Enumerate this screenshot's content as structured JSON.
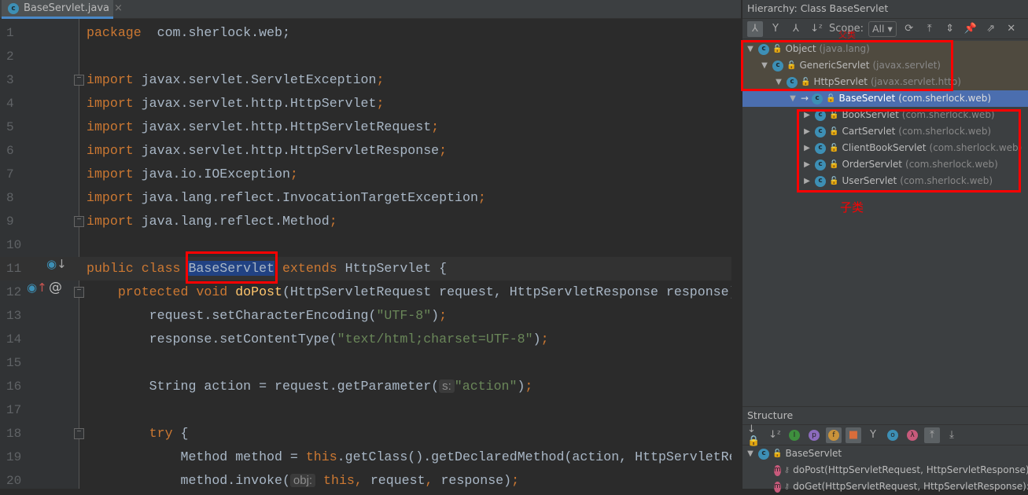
{
  "editor": {
    "tab": {
      "filename": "BaseServlet.java",
      "icon": "class-icon",
      "close": "×"
    },
    "lines": [
      {
        "n": "1",
        "tokens": [
          [
            "kw",
            "package"
          ],
          [
            "",
            "  com.sherlock.web;"
          ]
        ]
      },
      {
        "n": "2",
        "tokens": []
      },
      {
        "n": "3",
        "fold": true,
        "tokens": [
          [
            "kw",
            "import"
          ],
          [
            "",
            " javax.servlet.ServletException"
          ],
          [
            "kw",
            ";"
          ]
        ]
      },
      {
        "n": "4",
        "tokens": [
          [
            "kw",
            "import"
          ],
          [
            "",
            " javax.servlet.http.HttpServlet"
          ],
          [
            "kw",
            ";"
          ]
        ]
      },
      {
        "n": "5",
        "tokens": [
          [
            "kw",
            "import"
          ],
          [
            "",
            " javax.servlet.http.HttpServletRequest"
          ],
          [
            "kw",
            ";"
          ]
        ]
      },
      {
        "n": "6",
        "tokens": [
          [
            "kw",
            "import"
          ],
          [
            "",
            " javax.servlet.http.HttpServletResponse"
          ],
          [
            "kw",
            ";"
          ]
        ]
      },
      {
        "n": "7",
        "tokens": [
          [
            "kw",
            "import"
          ],
          [
            "",
            " java.io.IOException"
          ],
          [
            "kw",
            ";"
          ]
        ]
      },
      {
        "n": "8",
        "tokens": [
          [
            "kw",
            "import"
          ],
          [
            "",
            " java.lang.reflect.InvocationTargetException"
          ],
          [
            "kw",
            ";"
          ]
        ]
      },
      {
        "n": "9",
        "fold": true,
        "tokens": [
          [
            "kw",
            "import"
          ],
          [
            "",
            " java.lang.reflect.Method"
          ],
          [
            "kw",
            ";"
          ]
        ]
      },
      {
        "n": "10",
        "tokens": []
      },
      {
        "n": "11",
        "cur": true,
        "tokens": [
          [
            "kw",
            "public class "
          ],
          [
            "hl",
            "BaseServlet"
          ],
          [
            "kw",
            " extends "
          ],
          [
            "",
            "HttpServlet {"
          ]
        ]
      },
      {
        "n": "12",
        "fold": true,
        "tokens": [
          [
            "",
            "    "
          ],
          [
            "kw",
            "protected void "
          ],
          [
            "fn",
            "doPost"
          ],
          [
            "",
            "(HttpServletRequest request, HttpServletResponse response)"
          ]
        ]
      },
      {
        "n": "13",
        "tokens": [
          [
            "",
            "        request.setCharacterEncoding("
          ],
          [
            "str",
            "\"UTF-8\""
          ],
          [
            "",
            ")"
          ],
          [
            "kw",
            ";"
          ]
        ]
      },
      {
        "n": "14",
        "tokens": [
          [
            "",
            "        response.setContentType("
          ],
          [
            "str",
            "\"text/html;charset=UTF-8\""
          ],
          [
            "",
            ")"
          ],
          [
            "kw",
            ";"
          ]
        ]
      },
      {
        "n": "15",
        "tokens": []
      },
      {
        "n": "16",
        "tokens": [
          [
            "",
            "        String action = request.getParameter("
          ],
          [
            "hint",
            "s:"
          ],
          [
            "str",
            "\"action\""
          ],
          [
            "",
            ")"
          ],
          [
            "kw",
            ";"
          ]
        ]
      },
      {
        "n": "17",
        "tokens": []
      },
      {
        "n": "18",
        "fold": true,
        "tokens": [
          [
            "",
            "        "
          ],
          [
            "kw",
            "try"
          ],
          [
            "",
            " {"
          ]
        ]
      },
      {
        "n": "19",
        "tokens": [
          [
            "",
            "            Method method = "
          ],
          [
            "kw",
            "this"
          ],
          [
            "",
            ".getClass().getDeclaredMethod(action, HttpServletRequest.class, HttpServletResponse.class)"
          ]
        ]
      },
      {
        "n": "20",
        "tokens": [
          [
            "",
            "            method.invoke("
          ],
          [
            "hint",
            "obj:"
          ],
          [
            "kw",
            " this"
          ],
          [
            "kw",
            ","
          ],
          [
            "",
            " request"
          ],
          [
            "kw",
            ","
          ],
          [
            "",
            " response)"
          ],
          [
            "kw",
            ";"
          ]
        ]
      }
    ]
  },
  "hierarchy": {
    "title": "Hierarchy:  Class BaseServlet",
    "scope_label": "Scope:",
    "scope_value": "All",
    "annotation_parent": "父类",
    "annotation_child": "子类",
    "rows": [
      {
        "name": "Object",
        "pkg": "(java.lang)",
        "depth": 0,
        "expanded": true
      },
      {
        "name": "GenericServlet",
        "pkg": "(javax.servlet)",
        "depth": 1,
        "expanded": true
      },
      {
        "name": "HttpServlet",
        "pkg": "(javax.servlet.http)",
        "depth": 2,
        "expanded": true
      },
      {
        "name": "BaseServlet",
        "pkg": "(com.sherlock.web)",
        "depth": 3,
        "expanded": true,
        "selected": true
      },
      {
        "name": "BookServlet",
        "pkg": "(com.sherlock.web)",
        "depth": 4
      },
      {
        "name": "CartServlet",
        "pkg": "(com.sherlock.web)",
        "depth": 4
      },
      {
        "name": "ClientBookServlet",
        "pkg": "(com.sherlock.web)",
        "depth": 4
      },
      {
        "name": "OrderServlet",
        "pkg": "(com.sherlock.web)",
        "depth": 4
      },
      {
        "name": "UserServlet",
        "pkg": "(com.sherlock.web)",
        "depth": 4
      }
    ]
  },
  "structure": {
    "title": "Structure",
    "root": "BaseServlet",
    "members": [
      {
        "icon": "m",
        "label": "doPost(HttpServletRequest, HttpServletResponse):"
      },
      {
        "icon": "m",
        "label": "doGet(HttpServletRequest, HttpServletResponse):"
      }
    ]
  },
  "colors": {
    "keyword": "#cc7832",
    "string": "#6a8759",
    "method": "#ffc66d",
    "selection": "#4b6eaf",
    "annotation": "#ff0000"
  }
}
